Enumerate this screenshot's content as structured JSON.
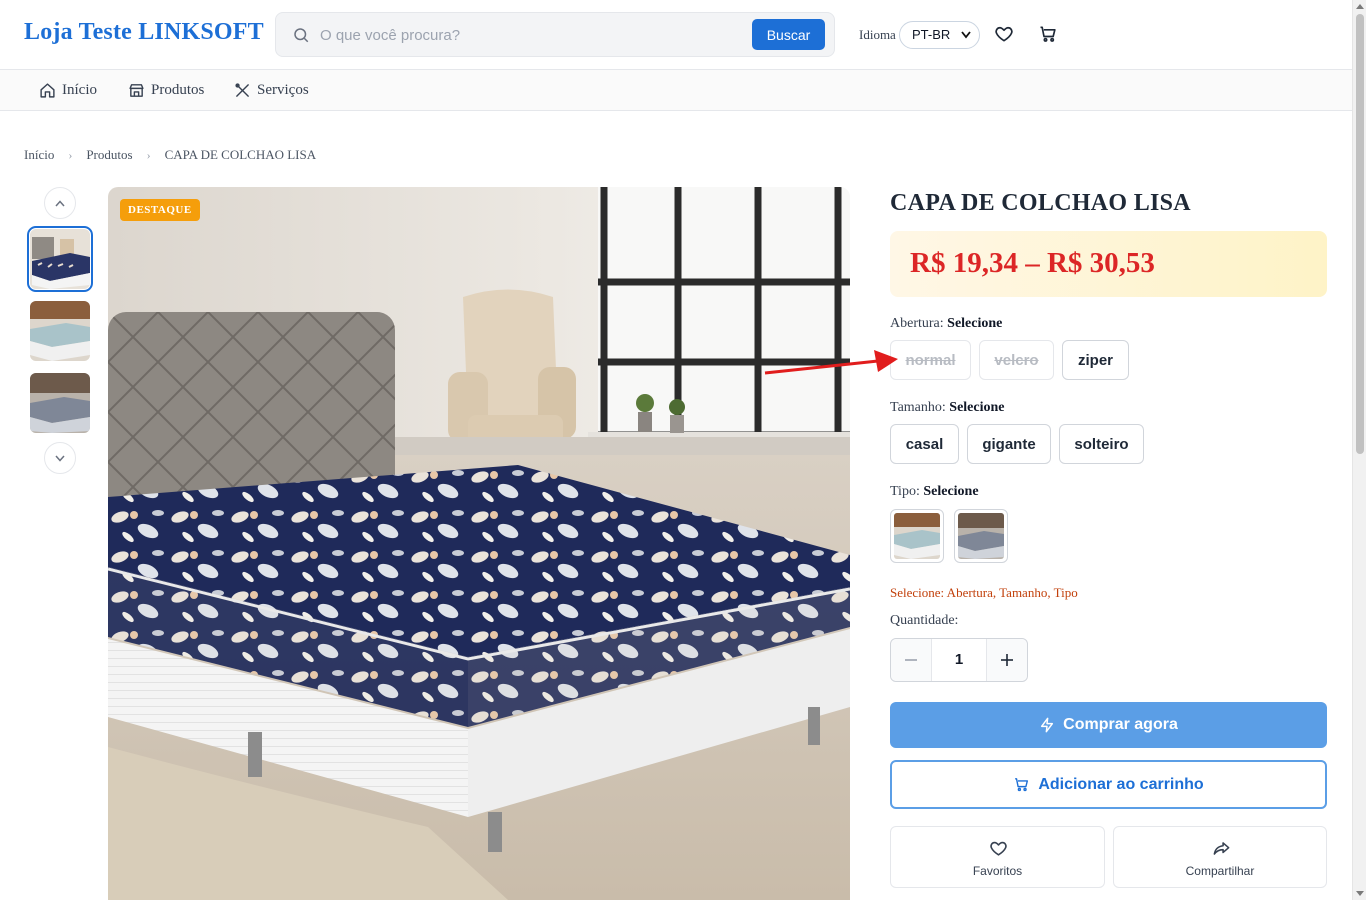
{
  "header": {
    "logo": "Loja Teste LINKSOFT",
    "search_placeholder": "O que você procura?",
    "search_button": "Buscar",
    "language_label": "Idioma",
    "language_value": "PT-BR"
  },
  "nav": {
    "items": [
      {
        "label": "Início",
        "icon": "home-icon"
      },
      {
        "label": "Produtos",
        "icon": "store-icon"
      },
      {
        "label": "Serviços",
        "icon": "tools-icon"
      }
    ]
  },
  "breadcrumb": [
    "Início",
    "Produtos",
    "CAPA DE COLCHAO LISA"
  ],
  "product": {
    "badge": "DESTAQUE",
    "title": "CAPA DE COLCHAO LISA",
    "price": "R$ 19,34 – R$ 30,53",
    "abertura": {
      "label": "Abertura:",
      "state": "Selecione",
      "options": [
        {
          "label": "normal",
          "available": false
        },
        {
          "label": "velcro",
          "available": false
        },
        {
          "label": "ziper",
          "available": true
        }
      ]
    },
    "tamanho": {
      "label": "Tamanho:",
      "state": "Selecione",
      "options": [
        {
          "label": "casal"
        },
        {
          "label": "gigante"
        },
        {
          "label": "solteiro"
        }
      ]
    },
    "tipo": {
      "label": "Tipo:",
      "state": "Selecione"
    },
    "hint": "Selecione: Abertura, Tamanho, Tipo",
    "quantity_label": "Quantidade:",
    "quantity": "1",
    "buy_now": "Comprar agora",
    "add_to_cart": "Adicionar ao carrinho",
    "favorites": "Favoritos",
    "share": "Compartilhar"
  },
  "colors": {
    "brand": "#1d6fd6",
    "price": "#dc2626",
    "badge": "#f59e0b",
    "annotation_arrow": "#e11d1d"
  }
}
